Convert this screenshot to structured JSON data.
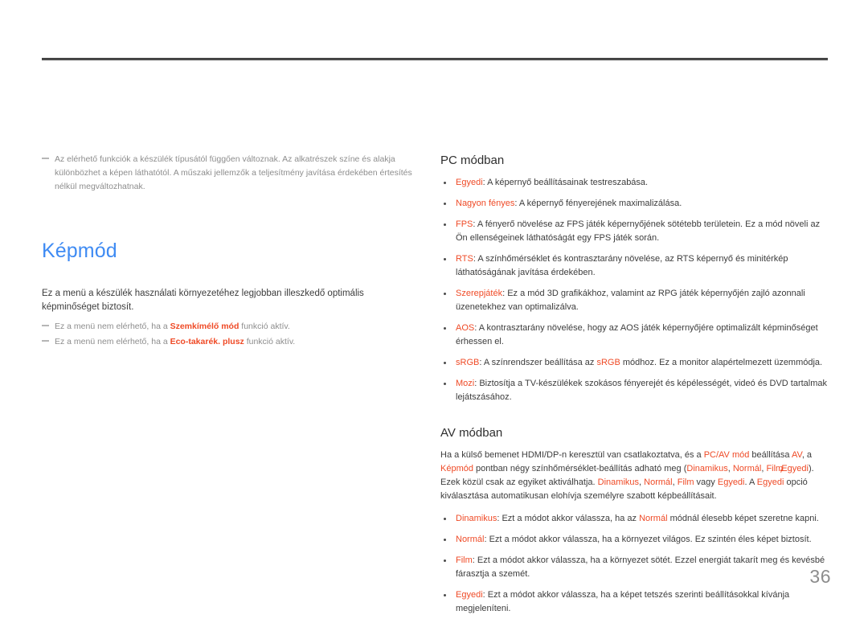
{
  "page": {
    "number": "36"
  },
  "left_column": {
    "top_note": "Az elérhető funkciók a készülék típusától függően változnak. Az alkatrészek színe és alakja különbözhet a képen láthatótól. A műszaki jellemzők a teljesítmény javítása érdekében értesítés nélkül megváltozhatnak.",
    "title": "Képmód",
    "lead": "Ez a menü a készülék használati környezetéhez legjobban illeszkedő optimális képminőséget biztosít.",
    "notes": [
      {
        "before": "Ez a menü nem elérhető, ha a ",
        "term": "Szemkímélő mód",
        "after": " funkció aktív."
      },
      {
        "before": "Ez a menü nem elérhető, ha a ",
        "term": "Eco-takarék. plusz",
        "after": " funkció aktív."
      }
    ]
  },
  "right_column": {
    "pc_section": {
      "heading": "PC módban",
      "items": [
        {
          "term": "Egyedi",
          "text": ": A képernyő beállításainak testreszabása."
        },
        {
          "term": "Nagyon fényes",
          "text": ": A képernyő fényerejének maximalizálása."
        },
        {
          "term": "FPS",
          "text": ": A fényerő növelése az FPS játék képernyőjének sötétebb területein. Ez a mód növeli az Ön ellenségeinek láthatóságát egy FPS játék során."
        },
        {
          "term": "RTS",
          "text": ": A színhőmérséklet és kontrasztarány növelése, az RTS képernyő és minitérkép láthatóságának javítása érdekében."
        },
        {
          "term": "Szerepjáték",
          "text": ": Ez a mód 3D grafikákhoz, valamint az RPG játék képernyőjén zajló azonnali üzenetekhez van optimalizálva."
        },
        {
          "term": "AOS",
          "text": ": A kontrasztarány növelése, hogy az AOS játék képernyőjére optimalizált képminőséget érhessen el."
        },
        {
          "term": "sRGB",
          "text_part1": ": A színrendszer beállítása az ",
          "inline_term": "sRGB",
          "text_part2": " módhoz. Ez a monitor alapértelmezett üzemmódja."
        },
        {
          "term": "Mozi",
          "text": ": Biztosítja a TV-készülékek szokásos fényerejét és képélességét, videó és DVD tartalmak lejátszásához."
        }
      ]
    },
    "av_section": {
      "heading": "AV módban",
      "paragraph": {
        "p1": "Ha a külső bemenet HDMI/DP-n keresztül van csatlakoztatva, és a ",
        "t1": "PC/AV mód",
        "p2": " beállítása ",
        "t2": "AV",
        "p3": ", a ",
        "t3": "Képmód",
        "p4": " pontban négy színhőmérséklet-beállítás adható meg (",
        "t4": "Dinamikus",
        "p5": ", ",
        "t5": "Normál",
        "p6": ", ",
        "t6": "Film",
        "p7": ", ",
        "t7": "Egyedi",
        "p8": "). Ezek közül csak az egyiket aktiválhatja. ",
        "t8": "Dinamikus",
        "p9": ", ",
        "t9": "Normál",
        "p10": ", ",
        "t10": "Film",
        "p11": " vagy ",
        "t11": "Egyedi",
        "p12": ". A ",
        "t12": "Egyedi",
        "p13": " opció kiválasztása automatikusan elohívja személyre szabott képbeállításait."
      },
      "items": [
        {
          "term": "Dinamikus",
          "text_part1": ": Ezt a módot akkor válassza, ha az ",
          "inline_term": "Normál",
          "text_part2": " módnál élesebb képet szeretne kapni."
        },
        {
          "term": "Normál",
          "text": ": Ezt a módot akkor válassza, ha a környezet világos. Ez szintén éles képet biztosít."
        },
        {
          "term": "Film",
          "text": ": Ezt a módot akkor válassza, ha a környezet sötét. Ezzel energiát takarít meg és kevésbé fárasztja a szemét."
        },
        {
          "term": "Egyedi",
          "text": ": Ezt a módot akkor válassza, ha a képet tetszés szerinti beállításokkal kívánja megjeleníteni."
        }
      ]
    }
  },
  "colors": {
    "accent": "#ef4a26",
    "title": "#3f8bf3",
    "body": "#3c3c3c",
    "muted": "#8d8d8d"
  }
}
